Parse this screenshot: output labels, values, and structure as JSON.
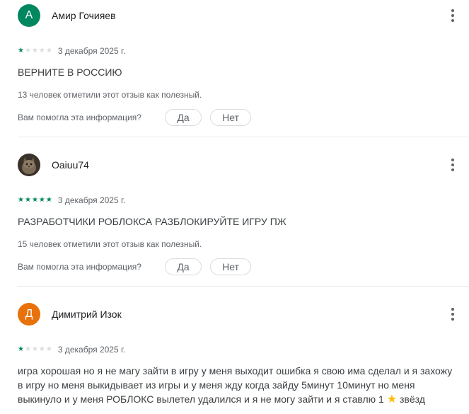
{
  "colors": {
    "avatar_a": "#01875f",
    "avatar_d": "#e8710a",
    "star_filled": "#01875f",
    "star_empty": "#dadce0",
    "inline_star": "#fbbc04"
  },
  "labels": {
    "question": "Вам помогла эта информация?",
    "yes": "Да",
    "no": "Нет"
  },
  "reviews": [
    {
      "avatar_letter": "А",
      "author": "Амир Гочияев",
      "rating": 1,
      "date": "3 декабря 2025 г.",
      "text": "ВЕРНИТЕ В РОССИЮ",
      "helpful": "13 человек отметили этот отзыв как полезный."
    },
    {
      "avatar_letter": "",
      "author": "Oaiuu74",
      "rating": 5,
      "date": "3 декабря 2025 г.",
      "text": "РАЗРАБОТЧИКИ РОБЛОКСА РАЗБЛОКИРУЙТЕ ИГРУ ПЖ",
      "helpful": "15 человек отметили этот отзыв как полезный."
    },
    {
      "avatar_letter": "Д",
      "author": "Димитрий Изок",
      "rating": 1,
      "date": "3 декабря 2025 г.",
      "text_line1": "игра хорошая но я не магу зайти в игру у меня выходит ошибка я свою има сделал и я захожу",
      "text_line2": "в игру но меня выкидывает из игры и у меня жду когда зайду 5минут 10минут но меня",
      "text_line3a": "выкинуло и у меня РОБЛОКС вылетел удалился и я не могу зайти и я ставлю 1",
      "text_line3b": "звёзд"
    }
  ]
}
